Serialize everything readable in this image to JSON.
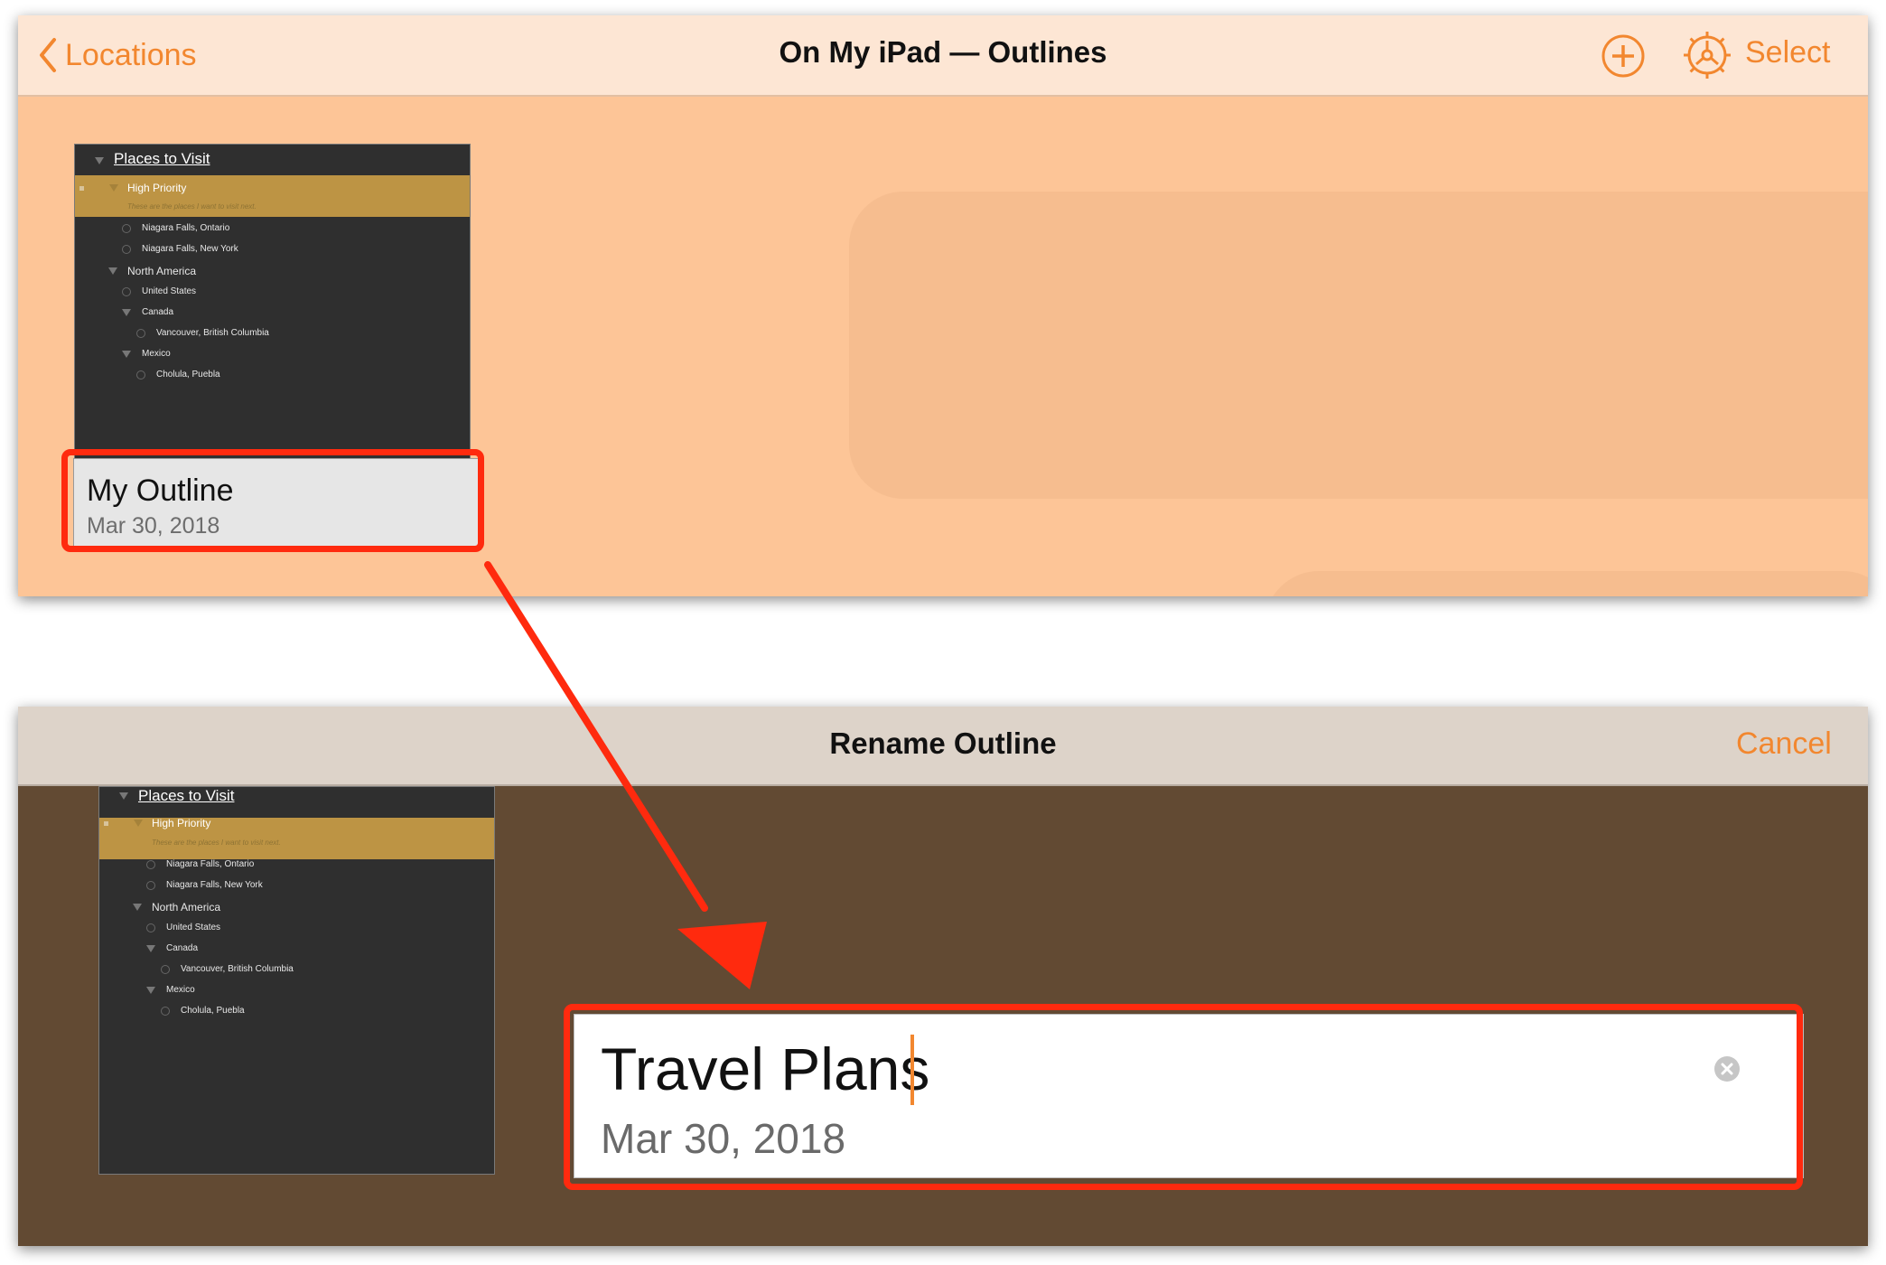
{
  "top_screen": {
    "nav": {
      "back_label": "Locations",
      "title": "On My iPad — Outlines",
      "select_label": "Select",
      "add_icon": "plus-circle-icon",
      "settings_icon": "gear-icon"
    },
    "document": {
      "name": "My Outline",
      "date": "Mar 30, 2018"
    }
  },
  "outline_preview": {
    "title": "Places to Visit",
    "high_priority": "High Priority",
    "note": "These are the places I want to visit next.",
    "items": [
      "Niagara Falls, Ontario",
      "Niagara Falls, New York"
    ],
    "north_america": "North America",
    "united_states": "United States",
    "canada": "Canada",
    "canada_item": "Vancouver, British Columbia",
    "mexico": "Mexico",
    "mexico_item": "Cholula, Puebla"
  },
  "bottom_screen": {
    "nav": {
      "title": "Rename Outline",
      "cancel_label": "Cancel"
    },
    "rename": {
      "value": "Travel Plans",
      "date": "Mar 30, 2018",
      "clear_icon": "clear-x-icon"
    }
  },
  "colors": {
    "accent": "#f2872f",
    "highlight": "#ff2a0e",
    "top_background": "#fdc597",
    "bottom_background": "#624a33",
    "outline_dark": "#2f2f2f",
    "priority_gold": "#bd9444"
  }
}
